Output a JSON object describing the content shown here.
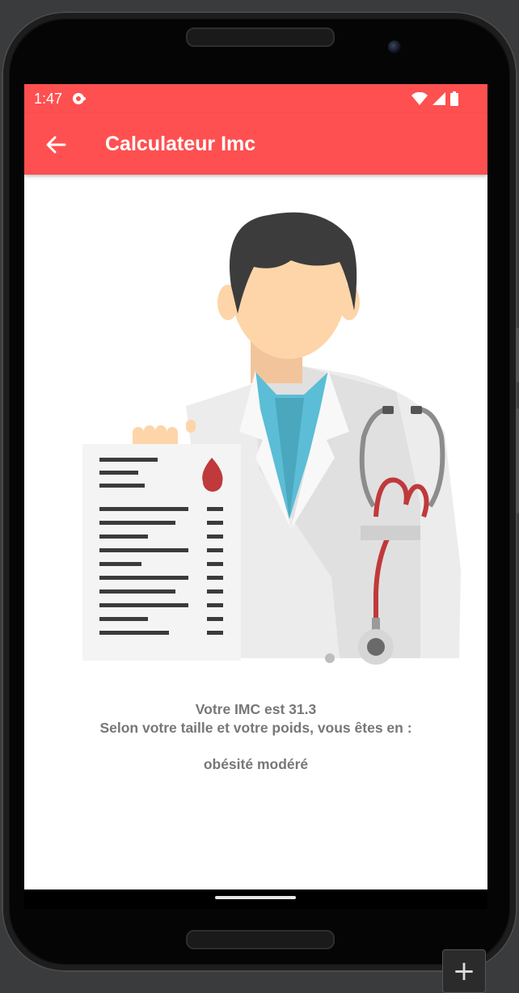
{
  "status_bar": {
    "time": "1:47",
    "icons": [
      "notification-icon",
      "wifi-icon",
      "signal-icon",
      "battery-icon"
    ]
  },
  "app_bar": {
    "title": "Calculateur Imc",
    "back_icon": "arrow-back-icon"
  },
  "result": {
    "bmi_label": "Votre IMC est  31.3",
    "description": "Selon votre taille et votre poids, vous êtes en :",
    "category": "obésité modéré"
  },
  "floating_button": {
    "label": "+"
  },
  "colors": {
    "primary": "#fe5050",
    "result_text": "#777777",
    "background": "#ffffff"
  }
}
